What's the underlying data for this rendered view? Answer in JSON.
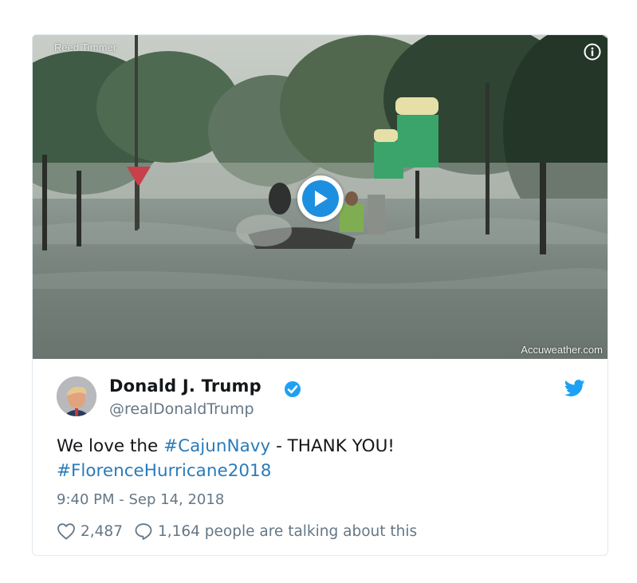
{
  "media": {
    "credit": "Reed Timmer",
    "source": "Accuweather.com"
  },
  "author": {
    "name": "Donald J. Trump",
    "handle": "@realDonaldTrump"
  },
  "tweet": {
    "text_before": "We love the ",
    "hashtag_1": "#CajunNavy",
    "text_after": " - THANK YOU!",
    "hashtag_2": "#FlorenceHurricane2018",
    "timestamp": "9:40 PM - Sep 14, 2018"
  },
  "actions": {
    "likes": "2,487",
    "talking": "1,164 people are talking about this"
  },
  "colors": {
    "link": "#2b7bb9",
    "play": "#1d8fe0",
    "verified": "#1da1f2",
    "secondary_text": "#657786"
  },
  "icons": [
    "info-icon",
    "play-icon",
    "verified-icon",
    "twitter-bird-icon",
    "heart-icon",
    "comment-icon"
  ]
}
